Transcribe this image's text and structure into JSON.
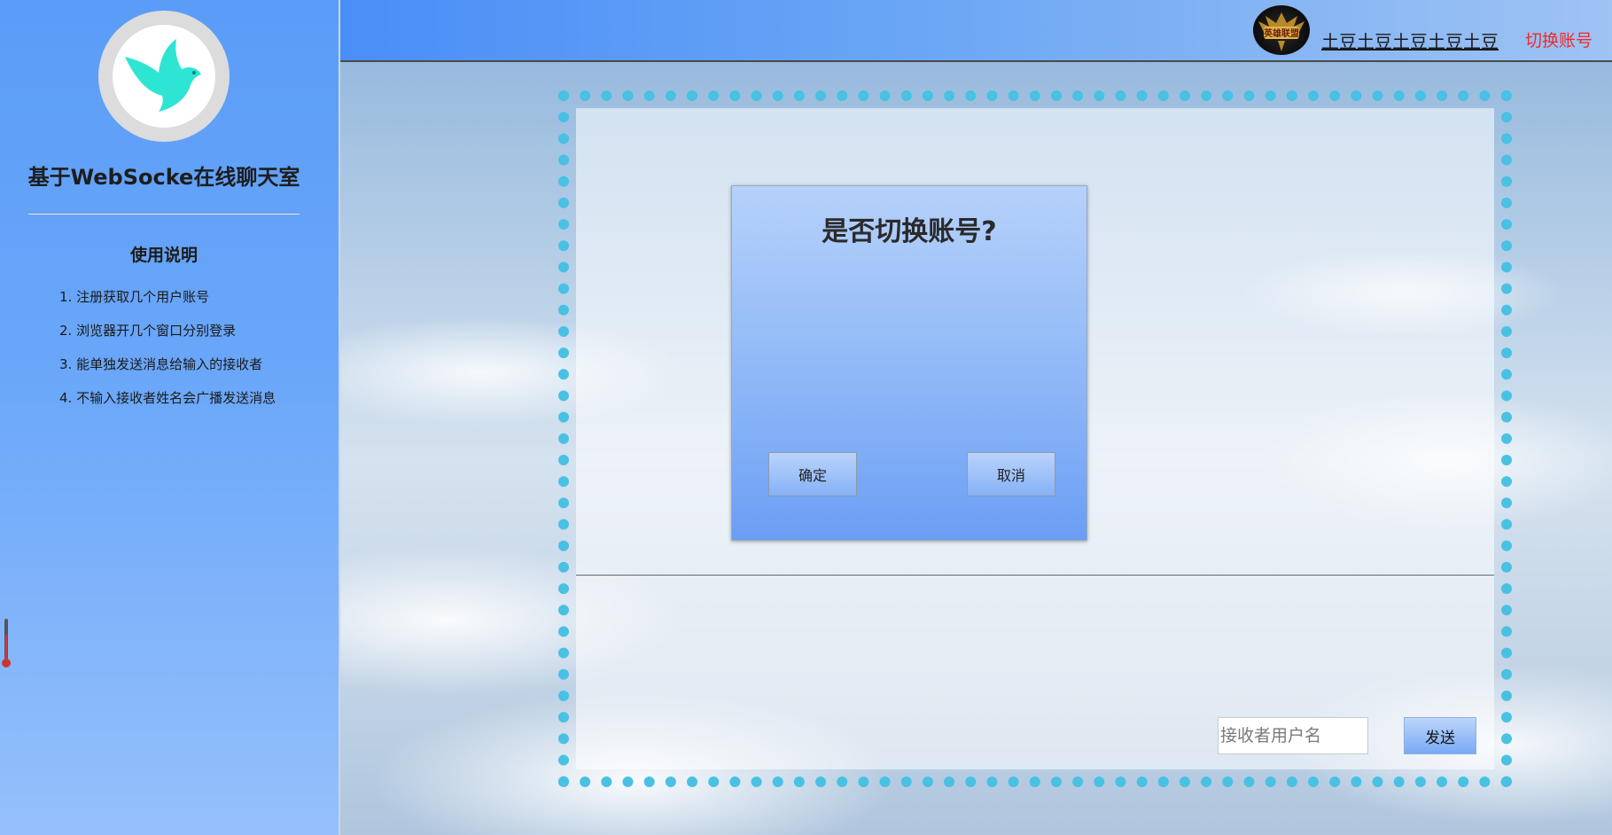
{
  "sidebar": {
    "app_title": "基于WebSocke在线聊天室",
    "instructions_heading": "使用说明",
    "instructions": [
      "1. 注册获取几个用户账号",
      "2. 浏览器开几个窗口分别登录",
      "3. 能单独发送消息给输入的接收者",
      "4. 不输入接收者姓名会广播发送消息"
    ],
    "logo_icon": "dove-icon"
  },
  "header": {
    "avatar_icon": "league-of-legends-avatar-icon",
    "avatar_text": "英雄联盟",
    "username": "土豆土豆土豆土豆土豆",
    "switch_account": "切换账号"
  },
  "chat": {
    "receiver_placeholder": "接收者用户名",
    "receiver_value": "",
    "send_label": "发送"
  },
  "dialog": {
    "title": "是否切换账号?",
    "confirm_label": "确定",
    "cancel_label": "取消"
  },
  "colors": {
    "sidebar_top": "#5a9cf8",
    "sidebar_bottom": "#95c0fb",
    "frame_dots": "#49c1e3",
    "switch_link": "#ee2b2b",
    "dove": "#2ee5d3"
  }
}
